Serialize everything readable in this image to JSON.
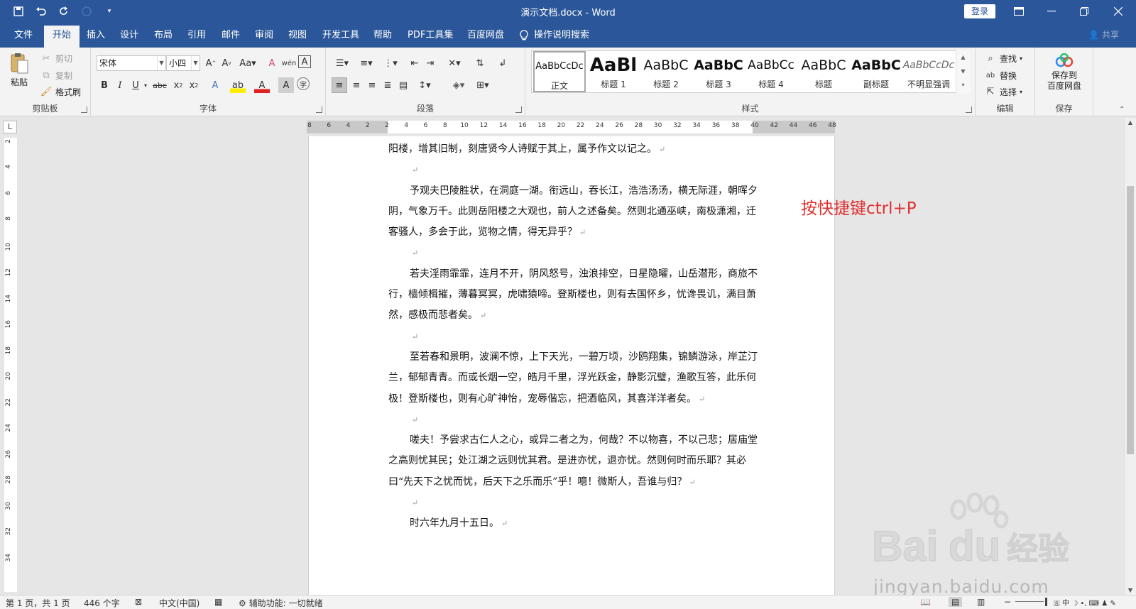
{
  "window": {
    "title": "演示文档.docx  -  Word",
    "login_label": "登录"
  },
  "qat": {
    "save": "save-icon",
    "undo": "undo-icon",
    "redo": "redo-icon",
    "touch": "touch-mode-icon",
    "customize": "customize-qat-icon"
  },
  "tabs": [
    "文件",
    "开始",
    "插入",
    "设计",
    "布局",
    "引用",
    "邮件",
    "审阅",
    "视图",
    "开发工具",
    "帮助",
    "PDF工具集",
    "百度网盘"
  ],
  "active_tab": "开始",
  "tellme": "操作说明搜索",
  "share": "共享",
  "ribbon": {
    "clipboard": {
      "paste": "粘贴",
      "cut": "剪切",
      "copy": "复制",
      "format_painter": "格式刷",
      "label": "剪贴板"
    },
    "font": {
      "font_name": "宋体",
      "font_size": "小四",
      "label": "字体"
    },
    "paragraph": {
      "label": "段落"
    },
    "styles": {
      "label": "样式",
      "items": [
        {
          "sample": "AaBbCcDc",
          "name": "正文"
        },
        {
          "sample": "AaBl",
          "name": "标题 1"
        },
        {
          "sample": "AaBbC",
          "name": "标题 2"
        },
        {
          "sample": "AaBbC",
          "name": "标题 3"
        },
        {
          "sample": "AaBbCc",
          "name": "标题 4"
        },
        {
          "sample": "AaBbC",
          "name": "标题"
        },
        {
          "sample": "AaBbC",
          "name": "副标题"
        },
        {
          "sample": "AaBbCcDc",
          "name": "不明显强调"
        }
      ]
    },
    "editing": {
      "find": "查找",
      "replace": "替换",
      "select": "选择",
      "label": "编辑"
    },
    "save": {
      "button": "保存到\n百度网盘",
      "label": "保存"
    }
  },
  "ruler": {
    "h_ticks": [
      "8",
      "6",
      "4",
      "2",
      "2",
      "4",
      "6",
      "8",
      "10",
      "12",
      "14",
      "16",
      "18",
      "20",
      "22",
      "24",
      "26",
      "28",
      "30",
      "32",
      "34",
      "36",
      "38",
      "40",
      "42",
      "44",
      "46",
      "48"
    ],
    "v_ticks": [
      "2",
      "4",
      "6",
      "8",
      "10",
      "12",
      "14",
      "16",
      "18",
      "20",
      "22",
      "24",
      "26",
      "28",
      "30",
      "32",
      "34"
    ]
  },
  "document": {
    "paragraphs": [
      {
        "text": "阳楼，增其旧制，刻唐贤今人诗赋于其上，属予作文以记之。",
        "indent": false
      },
      {
        "text": "",
        "indent": true
      },
      {
        "text": "予观夫巴陵胜状，在洞庭一湖。衔远山，吞长江，浩浩汤汤，横无际涯，朝晖夕阴，气象万千。此则岳阳楼之大观也，前人之述备矣。然则北通巫峡，南极潇湘，迁客骚人，多会于此，览物之情，得无异乎？",
        "indent": true
      },
      {
        "text": "",
        "indent": true
      },
      {
        "text": "若夫淫雨霏霏，连月不开，阴风怒号，浊浪排空，日星隐曜，山岳潜形，商旅不行，樯倾楫摧，薄暮冥冥，虎啸猿啼。登斯楼也，则有去国怀乡，忧谗畏讥，满目萧然，感极而悲者矣。",
        "indent": true
      },
      {
        "text": "",
        "indent": true
      },
      {
        "text": "至若春和景明，波澜不惊，上下天光，一碧万顷，沙鸥翔集，锦鳞游泳，岸芷汀兰，郁郁青青。而或长烟一空，皓月千里，浮光跃金，静影沉璧，渔歌互答，此乐何极！登斯楼也，则有心旷神怡，宠辱偕忘，把酒临风，其喜洋洋者矣。",
        "indent": true
      },
      {
        "text": "",
        "indent": true
      },
      {
        "text": "嗟夫！予尝求古仁人之心，或异二者之为，何哉？不以物喜，不以己悲；居庙堂之高则忧其民；处江湖之远则忧其君。是进亦忧，退亦忧。然则何时而乐耶？其必曰“先天下之忧而忧，后天下之乐而乐”乎！噫！微斯人，吾谁与归？",
        "indent": true
      },
      {
        "text": "",
        "indent": true
      },
      {
        "text": "时六年九月十五日。",
        "indent": true
      }
    ],
    "paragraph_mark": "↵"
  },
  "annotation": "按快捷键ctrl+P",
  "watermark": {
    "logo": "Baidu经验",
    "url": "jingyan.baidu.com"
  },
  "status": {
    "page": "第 1 页，共 1 页",
    "words": "446 个字",
    "language": "中文(中国)",
    "accessibility": "辅助功能: 一切就绪"
  },
  "colors": {
    "accent": "#2b579a",
    "annotation": "#e03030"
  }
}
